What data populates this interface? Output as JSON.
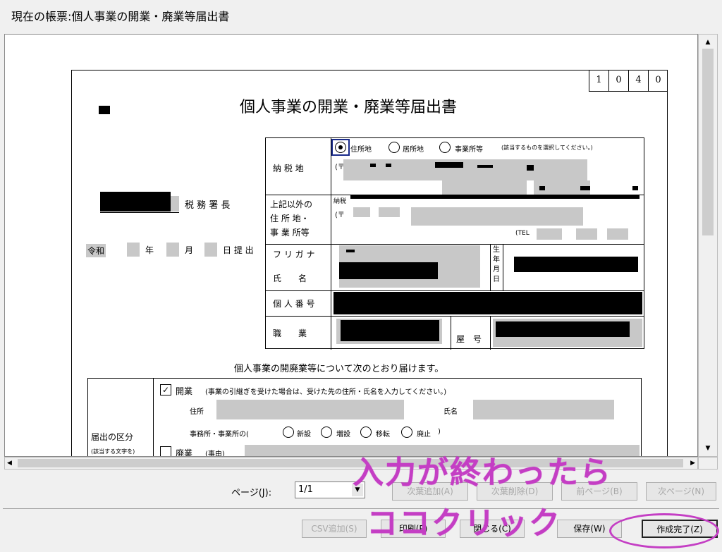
{
  "window": {
    "title": "現在の帳票:個人事業の開業・廃業等届出書"
  },
  "form": {
    "code": [
      "1",
      "0",
      "4",
      "0"
    ],
    "heading": "個人事業の開業・廃業等届出書",
    "tax_office_suffix": "税 務 署 長",
    "era": "令和",
    "date_labels": {
      "year": "年",
      "month": "月",
      "day": "日 提 出"
    },
    "nozeichi": {
      "label": "納 税 地",
      "options": [
        "住所地",
        "居所地",
        "事業所等"
      ],
      "selected": "住所地",
      "note": "(該当するものを選択してください。)",
      "postal_prefix": "(〒"
    },
    "other_address": {
      "label_lines": [
        "上記以外の",
        "住 所 地・",
        "事 業 所等"
      ],
      "small": "納税",
      "postal_prefix": "(〒",
      "tel_label": "(TEL"
    },
    "furigana_label": "フ リ ガ ナ",
    "name_label": "氏　　名",
    "birth_label": [
      "生",
      "年",
      "月",
      "日"
    ],
    "mynumber_label": "個 人 番 号",
    "job_label": "職　　業",
    "yago_label": "屋　号",
    "intro": "個人事業の開廃業等について次のとおり届けます。",
    "kubun": {
      "label": "届出の区分",
      "sub": "(該当する文字を)",
      "kaigyo_label": "開業",
      "kaigyo_checked": true,
      "kaigyo_note": "(事業の引継ぎを受けた場合は、受けた先の住所・氏名を入力してください。)",
      "address_label": "住所",
      "name_label": "氏名",
      "office_label": "事務所・事業所の(",
      "office_options": [
        "新設",
        "増設",
        "移転",
        "廃止"
      ],
      "office_close": ")",
      "haigyo_label": "廃業",
      "haigyo_checked": false,
      "reason_label": "(事由)"
    }
  },
  "footer": {
    "page_label": "ページ(J):",
    "page_value": "1/1",
    "buttons_row1": [
      {
        "label": "次葉追加(A)",
        "enabled": false
      },
      {
        "label": "次葉削除(D)",
        "enabled": false
      },
      {
        "label": "前ページ(B)",
        "enabled": false
      },
      {
        "label": "次ページ(N)",
        "enabled": false
      }
    ],
    "buttons_row2": [
      {
        "label": "CSV追加(S)",
        "enabled": false
      },
      {
        "label": "印刷(P)",
        "enabled": true
      },
      {
        "label": "閉じる(C)",
        "enabled": true
      },
      {
        "label": "保存(W)",
        "enabled": true
      },
      {
        "label": "作成完了(Z)",
        "enabled": true
      }
    ]
  },
  "annotation": {
    "line1": "入力が終わったら",
    "line2": "ココクリック",
    "color": "#c43ec4"
  }
}
